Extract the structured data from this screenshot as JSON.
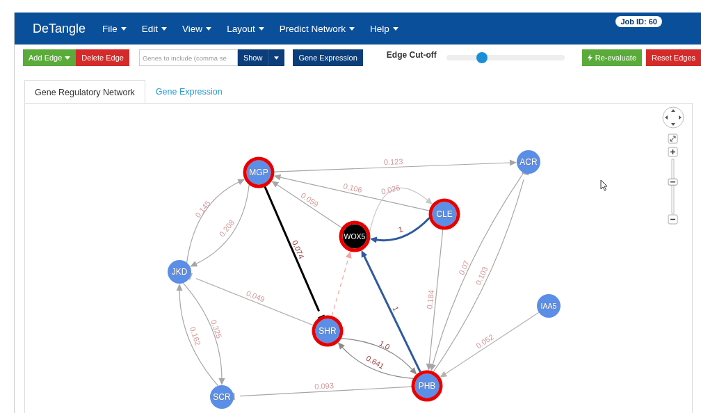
{
  "navbar": {
    "brand": "DeTangle",
    "menus": [
      {
        "label": "File"
      },
      {
        "label": "Edit"
      },
      {
        "label": "View"
      },
      {
        "label": "Layout"
      },
      {
        "label": "Predict Network"
      },
      {
        "label": "Help"
      }
    ],
    "job_badge": "Job ID: 60"
  },
  "toolbar": {
    "add_edge": "Add Edge",
    "delete_edge": "Delete Edge",
    "genes_field": {
      "placeholder": "Genes to include (comma se"
    },
    "show": "Show",
    "gene_expression": "Gene Expression",
    "cutoff_label": "Edge Cut-off",
    "cutoff": {
      "level": 0.3
    },
    "re_evaluate": "Re-evaluate",
    "reset_edges": "Reset Edges"
  },
  "tabs": [
    {
      "label": "Gene Regulatory Network",
      "selected": true
    },
    {
      "label": "Gene Expression",
      "selected": false
    }
  ],
  "network": {
    "zoom": {
      "level": 0.56
    },
    "nodes": [
      {
        "label": "MGP",
        "highlighted": true,
        "selected": false
      },
      {
        "label": "ACR",
        "highlighted": false,
        "selected": false
      },
      {
        "label": "CLE",
        "highlighted": true,
        "selected": false
      },
      {
        "label": "WOX5",
        "highlighted": true,
        "selected": true
      },
      {
        "label": "JKD",
        "highlighted": false,
        "selected": false
      },
      {
        "label": "IAA5",
        "highlighted": false,
        "selected": false
      },
      {
        "label": "SHR",
        "highlighted": true,
        "selected": false
      },
      {
        "label": "SCR",
        "highlighted": false,
        "selected": false
      },
      {
        "label": "PHB",
        "highlighted": true,
        "selected": false
      }
    ],
    "edges": [
      {
        "label": "0.123",
        "kind": "activation",
        "color": "#a6a6a6"
      },
      {
        "label": "0.106",
        "kind": "activation",
        "color": "#a6a6a6"
      },
      {
        "label": "0.059",
        "kind": "activation",
        "color": "#a6a6a6"
      },
      {
        "label": "0.026",
        "kind": "activation",
        "color": "#c8c8c8"
      },
      {
        "label": "1",
        "kind": "activation",
        "color": "#2d5aa0"
      },
      {
        "label": "0.145",
        "kind": "activation",
        "color": "#a6a6a6"
      },
      {
        "label": "0.208",
        "kind": "activation",
        "color": "#a6a6a6"
      },
      {
        "label": "0.074",
        "kind": "inhibition",
        "color": "#000000"
      },
      {
        "kind": "predicted",
        "color": "#f4a6a6"
      },
      {
        "label": "1",
        "kind": "activation",
        "color": "#2d5aa0"
      },
      {
        "label": "0.049",
        "kind": "inhibition",
        "color": "#b4b4b4"
      },
      {
        "label": "0.325",
        "kind": "activation",
        "color": "#a6a6a6"
      },
      {
        "label": "0.162",
        "kind": "activation",
        "color": "#a6a6a6"
      },
      {
        "label": "1.0",
        "kind": "activation",
        "color": "#8c8c8c"
      },
      {
        "label": "0.641",
        "kind": "activation",
        "color": "#8c8c8c"
      },
      {
        "label": "0.093",
        "kind": "inhibition",
        "color": "#a6a6a6"
      },
      {
        "label": "0.184",
        "kind": "activation",
        "color": "#a6a6a6"
      },
      {
        "label": "0.07",
        "kind": "activation",
        "color": "#a6a6a6"
      },
      {
        "label": "0.103",
        "kind": "inhibition",
        "color": "#a6a6a6"
      },
      {
        "label": "0.052",
        "kind": "activation",
        "color": "#b4b4b4"
      }
    ]
  }
}
